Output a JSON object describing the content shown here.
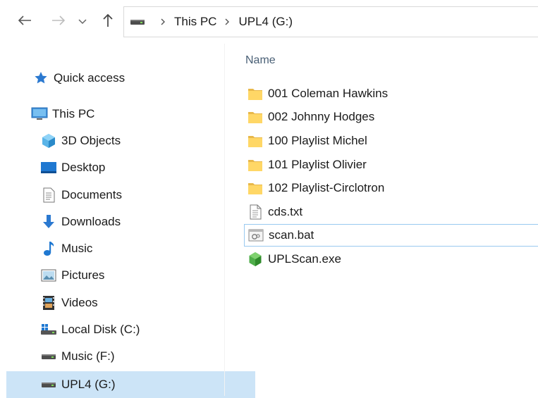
{
  "navigation": {
    "back_icon": "arrow-left-icon",
    "forward_icon": "arrow-right-icon",
    "recent_icon": "chevron-down-icon",
    "up_icon": "arrow-up-icon"
  },
  "address": {
    "segments": [
      "This PC",
      "UPL4 (G:)"
    ]
  },
  "sidebar": {
    "items": [
      {
        "label": "Quick access",
        "icon": "star-icon"
      },
      {
        "label": "This PC",
        "icon": "computer-icon"
      },
      {
        "label": "3D Objects",
        "icon": "cube-icon"
      },
      {
        "label": "Desktop",
        "icon": "desktop-icon"
      },
      {
        "label": "Documents",
        "icon": "document-icon"
      },
      {
        "label": "Downloads",
        "icon": "download-icon"
      },
      {
        "label": "Music",
        "icon": "music-note-icon"
      },
      {
        "label": "Pictures",
        "icon": "picture-icon"
      },
      {
        "label": "Videos",
        "icon": "film-icon"
      },
      {
        "label": "Local Disk (C:)",
        "icon": "windows-drive-icon"
      },
      {
        "label": "Music (F:)",
        "icon": "drive-icon"
      },
      {
        "label": "UPL4 (G:)",
        "icon": "drive-icon"
      }
    ],
    "selected": "UPL4 (G:)"
  },
  "main": {
    "column_header": "Name",
    "files": [
      {
        "name": "001 Coleman Hawkins",
        "icon": "folder-icon"
      },
      {
        "name": "002 Johnny Hodges",
        "icon": "folder-icon"
      },
      {
        "name": "100 Playlist Michel",
        "icon": "folder-icon"
      },
      {
        "name": "101 Playlist Olivier",
        "icon": "folder-icon"
      },
      {
        "name": "102 Playlist-Circlotron",
        "icon": "folder-icon"
      },
      {
        "name": "cds.txt",
        "icon": "text-file-icon"
      },
      {
        "name": "scan.bat",
        "icon": "batch-file-icon"
      },
      {
        "name": "UPLScan.exe",
        "icon": "executable-icon"
      }
    ],
    "focused": "scan.bat"
  },
  "colors": {
    "accent": "#0078d7",
    "selection": "#cce4f7",
    "focus_border": "#99c9f0",
    "folder": "#ffd766"
  }
}
